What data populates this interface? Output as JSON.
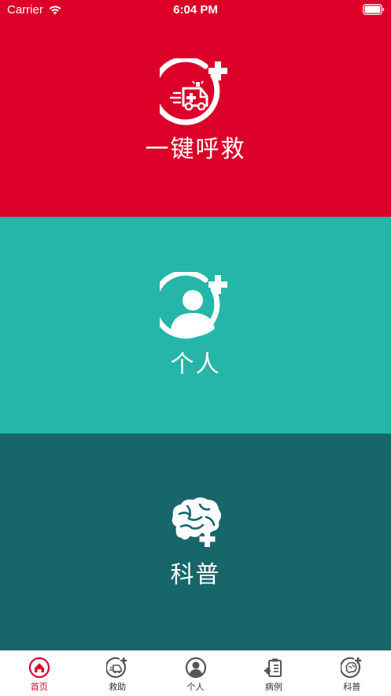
{
  "status_bar": {
    "carrier": "Carrier",
    "time": "6:04 PM"
  },
  "colors": {
    "emergency_red": "#dc0029",
    "personal_teal": "#25b5a9",
    "science_dark_teal": "#17666a",
    "tab_active": "#dc0029",
    "tab_inactive": "#555555"
  },
  "panels": {
    "emergency": {
      "label": "一键呼救",
      "icon": "ambulance-plus-icon"
    },
    "personal": {
      "label": "个人",
      "icon": "user-plus-icon"
    },
    "science": {
      "label": "科普",
      "icon": "brain-plus-icon"
    }
  },
  "tabs": [
    {
      "label": "首页",
      "icon": "home-icon",
      "active": true
    },
    {
      "label": "救助",
      "icon": "ambulance-icon",
      "active": false
    },
    {
      "label": "个人",
      "icon": "user-icon",
      "active": false
    },
    {
      "label": "病例",
      "icon": "clipboard-icon",
      "active": false
    },
    {
      "label": "科普",
      "icon": "brain-icon",
      "active": false
    }
  ]
}
